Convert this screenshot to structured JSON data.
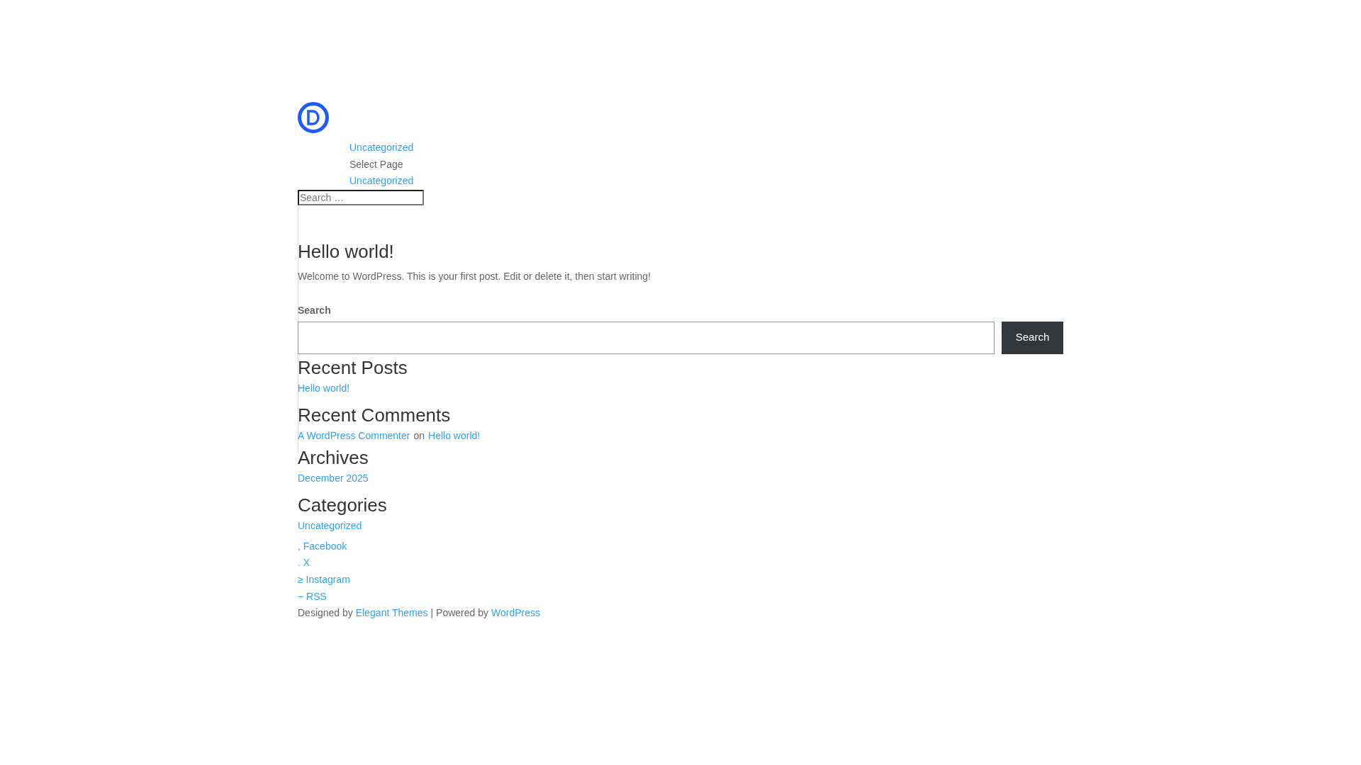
{
  "header": {
    "nav_top": "Uncategorized",
    "select_page": "Select Page",
    "nav_bottom": "Uncategorized",
    "search": {
      "placeholder": "Search …"
    }
  },
  "post": {
    "title": "Hello world!",
    "excerpt": "Welcome to WordPress. This is your first post. Edit or delete it, then start writing!"
  },
  "search_widget": {
    "label": "Search",
    "button": "Search"
  },
  "recent_posts": {
    "title": "Recent Posts",
    "items": [
      "Hello world!"
    ]
  },
  "recent_comments": {
    "title": "Recent Comments",
    "items": [
      {
        "author": "A WordPress Commenter",
        "on": "on",
        "post": "Hello world!"
      }
    ]
  },
  "archives": {
    "title": "Archives",
    "items": [
      "December 2025"
    ]
  },
  "categories": {
    "title": "Categories",
    "items": [
      "Uncategorized"
    ]
  },
  "social_links": [
    ", Facebook",
    ". X",
    "≥ Instagram",
    "− RSS"
  ],
  "footer": {
    "designed_by": "Designed by",
    "theme_link": "Elegant Themes",
    "powered_by": "| Powered by",
    "wp_link": "WordPress"
  }
}
